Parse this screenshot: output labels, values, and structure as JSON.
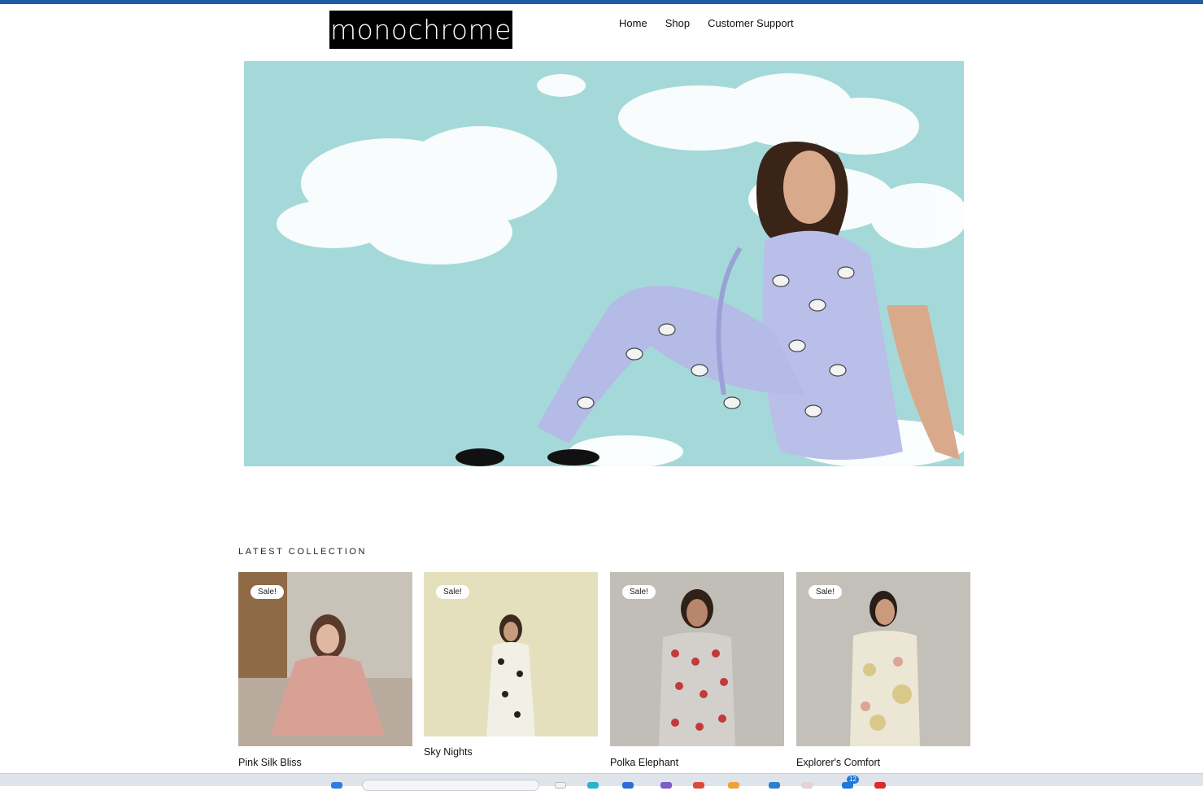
{
  "brand": {
    "logo_text": "monochrome"
  },
  "nav": {
    "items": [
      "Home",
      "Shop",
      "Customer Support"
    ]
  },
  "section": {
    "title": "LATEST COLLECTION"
  },
  "products": [
    {
      "name": "Pink Silk Bliss",
      "badge": "Sale!",
      "bg": "#b9b1aa"
    },
    {
      "name": "Sky Nights",
      "badge": "Sale!",
      "bg": "#e4e0bd"
    },
    {
      "name": "Polka Elephant",
      "badge": "Sale!",
      "bg": "#c1bdb7"
    },
    {
      "name": "Explorer's Comfort",
      "badge": "Sale!",
      "bg": "#c3c0ba"
    }
  ],
  "colors": {
    "accent": "#1f5aa6",
    "hero_bg": "#a5d9d9"
  },
  "taskbar": {
    "badge_count": "12"
  }
}
